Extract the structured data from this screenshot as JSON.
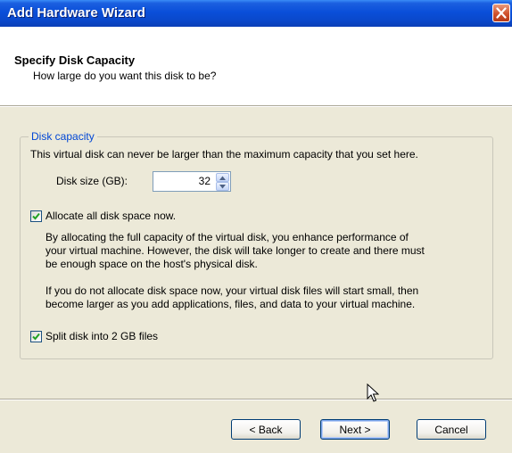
{
  "window": {
    "title": "Add Hardware Wizard"
  },
  "header": {
    "title": "Specify Disk Capacity",
    "subtitle": "How large do you want this disk to be?"
  },
  "group": {
    "legend": "Disk capacity",
    "description": "This virtual disk can never be larger than the maximum capacity that you set here.",
    "disk_size": {
      "label": "Disk size (GB):",
      "value": "32"
    },
    "allocate": {
      "label": "Allocate all disk space now.",
      "checked": true,
      "info1": "By allocating the full capacity of the virtual disk, you enhance performance of\nyour virtual machine.  However, the disk will take longer to create and there must\nbe enough space on the host's physical disk.",
      "info2": "If you do not allocate disk space now, your virtual disk files will start small, then\nbecome larger as you add applications, files, and data to your virtual machine."
    },
    "split": {
      "label": "Split disk into 2 GB files",
      "checked": true
    }
  },
  "buttons": {
    "back": "< Back",
    "next": "Next >",
    "cancel": "Cancel"
  },
  "colors": {
    "legend": "#0046d5",
    "titlebar": "#0a4fd9",
    "close": "#d0522d"
  }
}
